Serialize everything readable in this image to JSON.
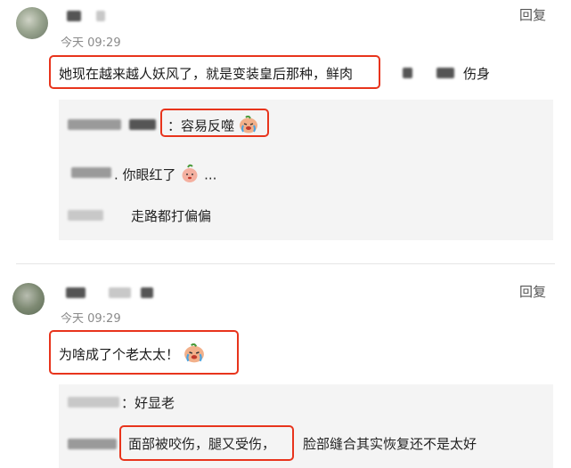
{
  "comments": [
    {
      "time": "今天 09:29",
      "reply_label": "回复",
      "text_start": "她现在越来越人妖风了，就是变装皇后那种，鲜肉",
      "text_end": "伤身",
      "replies": [
        {
          "text": "：容易反噬",
          "emoji": "crying-face-icon"
        },
        {
          "text": ". 你眼红了",
          "emoji": "peach-face-icon",
          "suffix": "..."
        },
        {
          "text": "走路都打偏偏"
        }
      ]
    },
    {
      "time": "今天 09:29",
      "reply_label": "回复",
      "text": "为啥成了个老太太！",
      "replies": [
        {
          "text": "：好显老"
        },
        {
          "text": "面部被咬伤，腿又受伤，",
          "text_tail": "脸部缝合其实恢复还不是太好"
        }
      ]
    }
  ],
  "colors": {
    "highlight": "#e8341c",
    "panel": "#f4f4f4"
  }
}
